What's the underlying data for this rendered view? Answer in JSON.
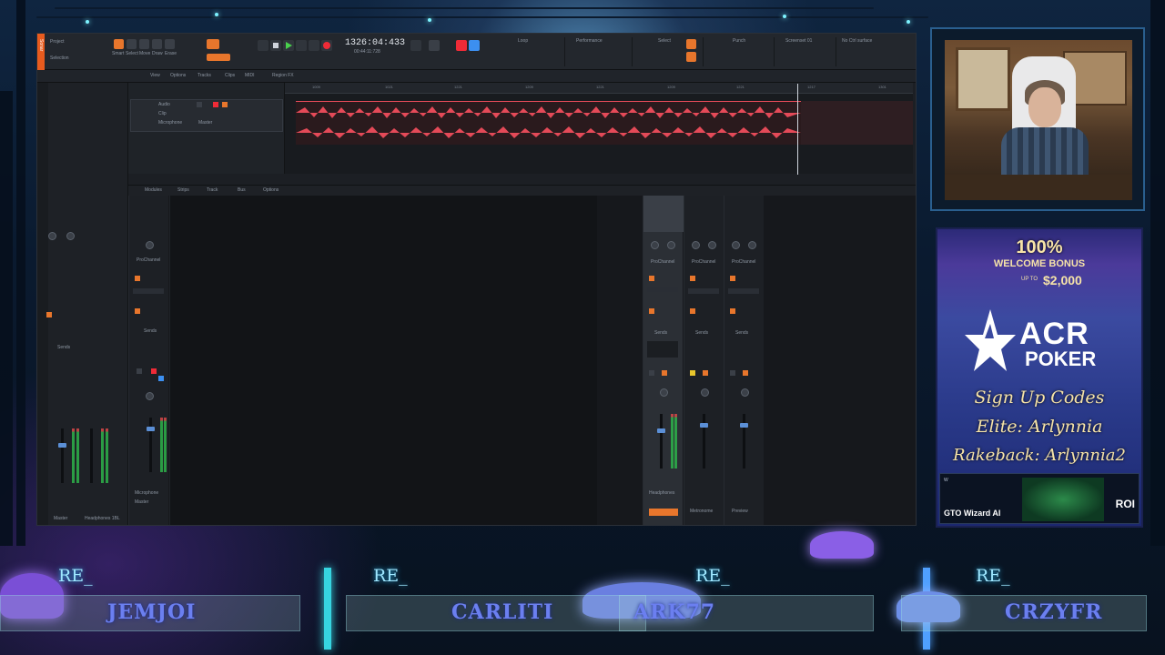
{
  "daw": {
    "app_name": "Sonar",
    "time_display": "1326:04:433",
    "time_sub": "00:44:11:728",
    "tools": [
      "Smart",
      "Select",
      "Move",
      "Draw",
      "Erase"
    ],
    "control_modules": [
      "Loop",
      "Performance",
      "Select",
      "Punch",
      "Screenset 01",
      "No Ctrl surface"
    ],
    "track_menu": [
      "View",
      "Options",
      "Tracks",
      "Clips",
      "MIDI",
      "Region FX"
    ],
    "console_menu": [
      "Modules",
      "Strips",
      "Track",
      "Bus",
      "Options"
    ],
    "ruler_ticks": [
      "1009",
      "1021",
      "1221",
      "1209",
      "1221",
      "1209",
      "1221",
      "1217",
      "1301"
    ],
    "track": {
      "name": "Audio",
      "input": "Microphone",
      "output": "Master",
      "clip_label": "Clip"
    },
    "strips": [
      {
        "name": "Microphone",
        "output": "Master",
        "section": "ProChannel",
        "sends": "Sends"
      },
      {
        "name": "Headphones",
        "output": "Master",
        "section": "ProChannel",
        "sends": "Sends"
      },
      {
        "name": "Metronome",
        "output": "Master",
        "section": "ProChannel",
        "sends": "Sends"
      },
      {
        "name": "Preview",
        "output": "Master",
        "section": "ProChannel",
        "sends": "Sends"
      }
    ],
    "rail_labels": {
      "master": "Master",
      "headphones": "Headphones 1BL",
      "sends": "Sends"
    },
    "accent_color": "#e8762c",
    "clip_color": "#e44a58"
  },
  "ad": {
    "bonus_line1": "100%",
    "bonus_line2": "WELCOME BONUS",
    "bonus_up": "UP TO",
    "bonus_amount": "$2,000",
    "brand": "ACR",
    "brand_sub": "POKER",
    "sign_up": "Sign Up Codes",
    "elite": "Elite: Arlynnia",
    "rakeback": "Rakeback: Arlynnia2",
    "gto_title": "GTO Wizard AI",
    "gto_roi": "ROI"
  },
  "banner": {
    "prefix": "RE_",
    "names": [
      "JEMJOI",
      "CARLITI",
      "ARK77",
      "CRZYFR"
    ]
  }
}
